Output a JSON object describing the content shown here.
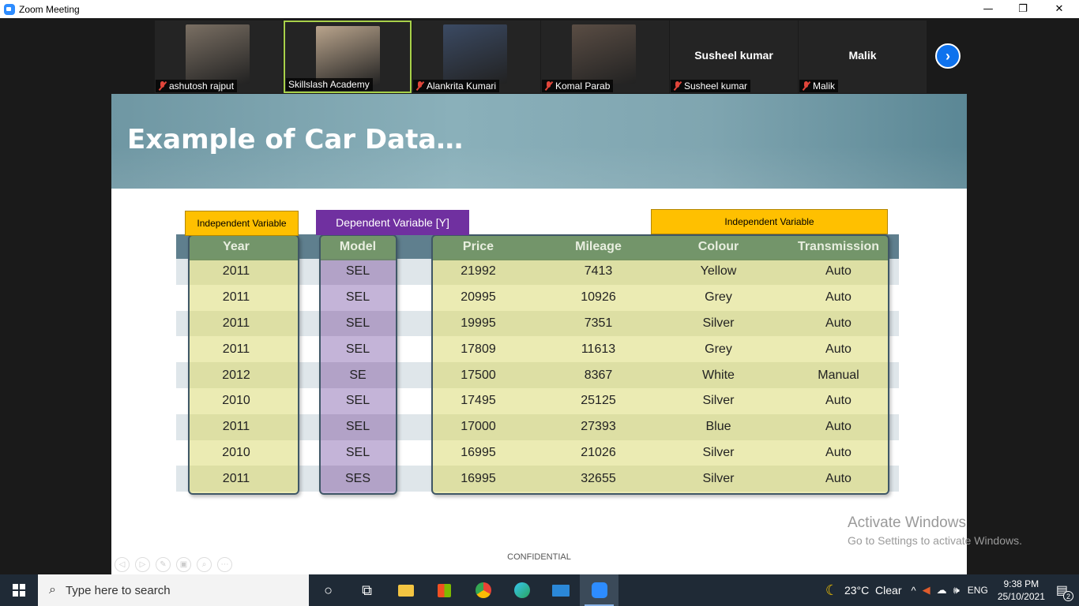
{
  "window": {
    "title": "Zoom Meeting",
    "minimize": "—",
    "restore": "❐",
    "close": "✕"
  },
  "participants": [
    {
      "name": "ashutosh rajput",
      "muted": true,
      "photo_color": "#7a6f63"
    },
    {
      "name": "Skillslash Academy",
      "muted": false,
      "active": true,
      "photo_color": "#b9a48c"
    },
    {
      "name": "Alankrita Kumari",
      "muted": true,
      "photo_color": "#3b4a63"
    },
    {
      "name": "Komal Parab",
      "muted": true,
      "photo_color": "#5a4d44"
    },
    {
      "name": "Susheel kumar",
      "muted": true,
      "big_label": "Susheel kumar"
    },
    {
      "name": "Malik",
      "muted": true,
      "big_label": "Malik"
    }
  ],
  "next_icon": "chevron-right-icon",
  "slide": {
    "title": "Example of Car Data…",
    "tags": {
      "independent_left": "Independent Variable",
      "dependent": "Dependent Variable [Y]",
      "independent_right": "Independent Variable"
    },
    "columns": [
      "Year",
      "Model",
      "Price",
      "Mileage",
      "Colour",
      "Transmission"
    ],
    "rows": [
      [
        "2011",
        "SEL",
        "21992",
        "7413",
        "Yellow",
        "Auto"
      ],
      [
        "2011",
        "SEL",
        "20995",
        "10926",
        "Grey",
        "Auto"
      ],
      [
        "2011",
        "SEL",
        "19995",
        "7351",
        "Silver",
        "Auto"
      ],
      [
        "2011",
        "SEL",
        "17809",
        "11613",
        "Grey",
        "Auto"
      ],
      [
        "2012",
        "SE",
        "17500",
        "8367",
        "White",
        "Manual"
      ],
      [
        "2010",
        "SEL",
        "17495",
        "25125",
        "Silver",
        "Auto"
      ],
      [
        "2011",
        "SEL",
        "17000",
        "27393",
        "Blue",
        "Auto"
      ],
      [
        "2010",
        "SEL",
        "16995",
        "21026",
        "Silver",
        "Auto"
      ],
      [
        "2011",
        "SES",
        "16995",
        "32655",
        "Silver",
        "Auto"
      ]
    ],
    "footer": "CONFIDENTIAL",
    "colors": {
      "yellow_fill": "#ebebb3",
      "purple_fill": "#c4b4d8",
      "header_green": "#73956a"
    }
  },
  "watermark": {
    "line1": "Activate Windows",
    "line2": "Go to Settings to activate Windows."
  },
  "taskbar": {
    "search_placeholder": "Type here to search",
    "weather": "23°C  Clear",
    "lang": "ENG",
    "time": "9:38 PM",
    "date": "25/10/2021",
    "notifications": "2"
  }
}
